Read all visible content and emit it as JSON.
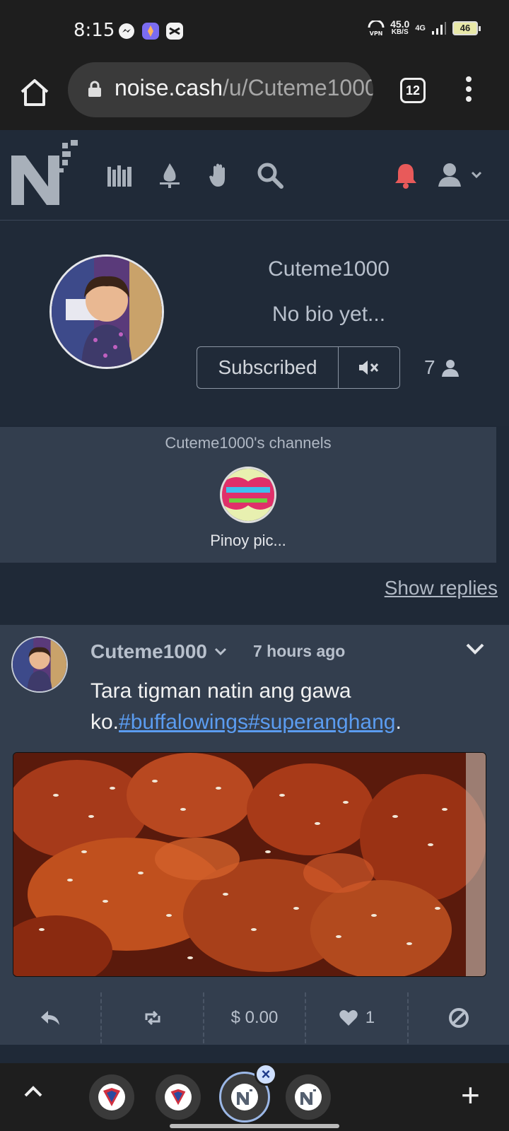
{
  "status_bar": {
    "time": "8:15",
    "net_speed": "45.0",
    "net_unit": "KB/S",
    "network": "4G",
    "vpn": "VPN",
    "battery": "46"
  },
  "browser": {
    "url_domain": "noise.cash",
    "url_path": "/u/Cuteme1000",
    "tab_count": "12"
  },
  "site_nav": {
    "icons": [
      "library-icon",
      "flame-icon",
      "hand-icon",
      "search-icon",
      "bell-icon",
      "user-icon"
    ],
    "accent": "#e85a5a"
  },
  "profile": {
    "username": "Cuteme1000",
    "bio": "No bio yet...",
    "subscribe_label": "Subscribed",
    "subscriber_count": "7"
  },
  "channels": {
    "title": "Cuteme1000's channels",
    "items": [
      {
        "name": "Pinoy pic..."
      }
    ]
  },
  "show_replies": "Show replies",
  "post": {
    "author": "Cuteme1000",
    "time": "7 hours ago",
    "text_prefix": "Tara tigman natin ang gawa ko.",
    "hashtags": "#buffalowings#superanghang",
    "text_suffix": ".",
    "tip_amount": "$ 0.00",
    "likes": "1"
  }
}
